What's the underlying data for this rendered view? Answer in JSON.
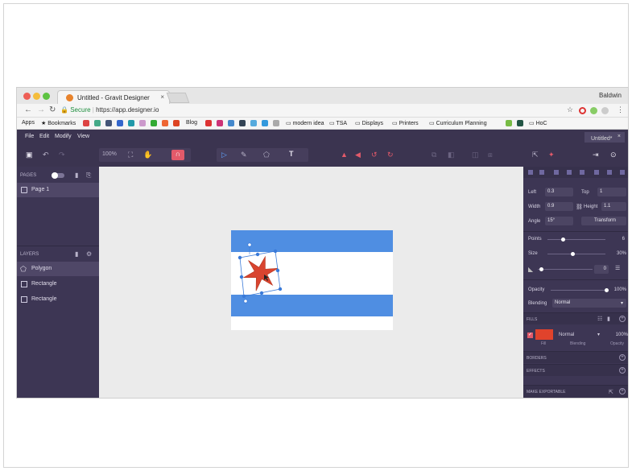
{
  "browser": {
    "tab_title": "Untitled - Gravit Designer",
    "tab_close": "×",
    "profile_name": "Baldwin",
    "secure_label": "Secure",
    "url": "https://app.designer.io",
    "bookmarks": [
      "Apps",
      "Bookmarks",
      "Blog",
      "modern idea",
      "TSA",
      "Displays",
      "Printers",
      "Curriculum Planning",
      "HoC"
    ]
  },
  "app": {
    "menu": [
      "File",
      "Edit",
      "Modify",
      "View"
    ],
    "document_tab": "Untitled*",
    "zoom_label": "100%",
    "pages_title": "PAGES",
    "pages": [
      "Page 1"
    ],
    "layers_title": "LAYERS",
    "layers": [
      "Polygon",
      "Rectangle",
      "Rectangle"
    ],
    "selected_layer_index": 0
  },
  "inspector": {
    "left_label": "Left",
    "left_value": "0.3",
    "top_label": "Top",
    "top_value": "1",
    "width_label": "Width",
    "width_value": "0.9",
    "height_label": "Height",
    "height_value": "1.1",
    "angle_label": "Angle",
    "angle_value": "15°",
    "transform_label": "Transform",
    "points_label": "Points",
    "points_value": "6",
    "size_label": "Size",
    "size_value": "30%",
    "radius_value": "0",
    "opacity_label": "Opacity",
    "opacity_value": "100%",
    "blending_label": "Blending",
    "blending_value": "Normal",
    "fills_title": "FILLS",
    "fill_blend": "Normal",
    "fill_opacity": "100%",
    "fill_caption_fill": "Fill",
    "fill_caption_blending": "Blending",
    "fill_caption_opacity": "Opacity",
    "borders_title": "BORDERS",
    "effects_title": "EFFECTS",
    "exportable_title": "MAKE EXPORTABLE"
  },
  "colors": {
    "ui_dark": "#3d3654",
    "stripe_blue": "#4f8ee2",
    "star_red": "#d9442f",
    "fill_swatch": "#e0432c",
    "selection_blue": "#3a7ad8"
  }
}
